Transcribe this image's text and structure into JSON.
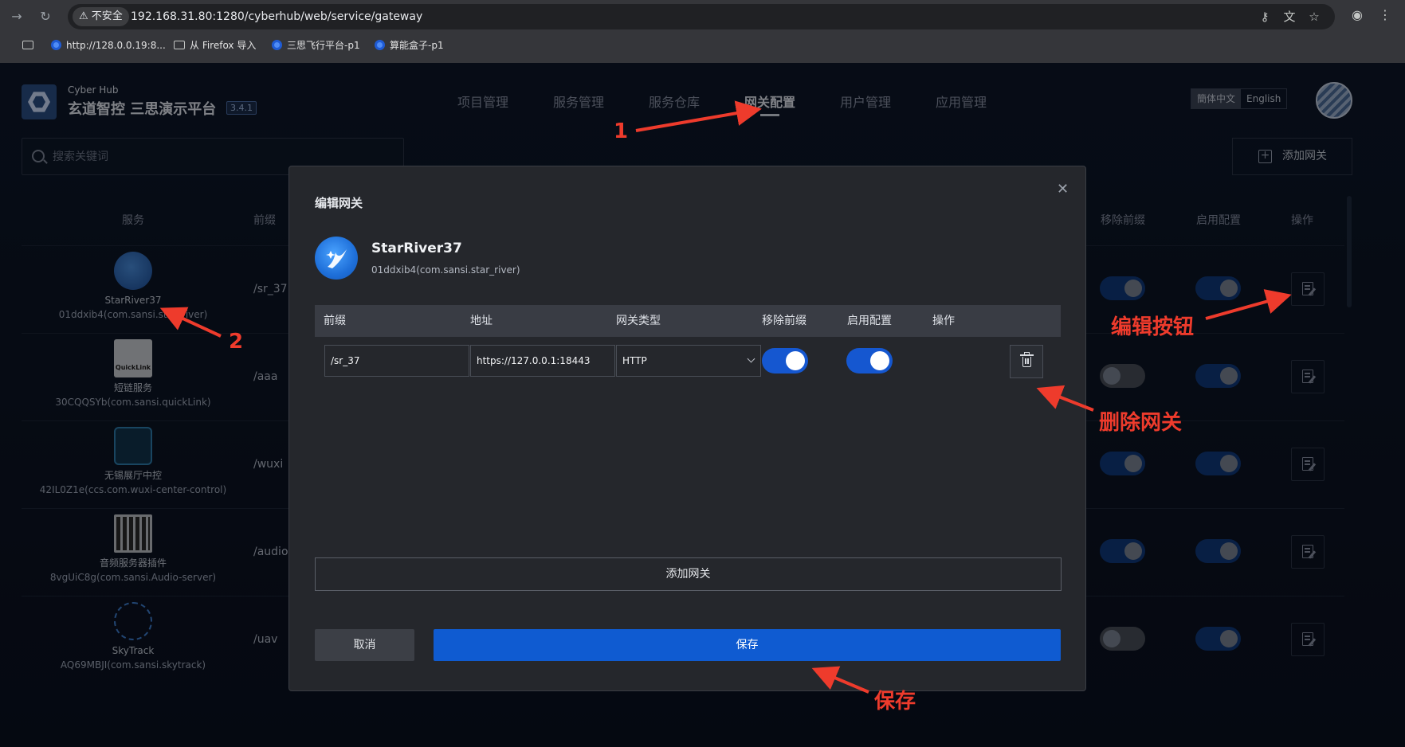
{
  "browser": {
    "insecure_label": "不安全",
    "url": "192.168.31.80:1280/cyberhub/web/service/gateway",
    "bookmarks": [
      "http://128.0.0.19:8...",
      "从 Firefox 导入",
      "三思飞行平台-p1",
      "算能盒子-p1"
    ]
  },
  "header": {
    "brand_sub": "Cyber Hub",
    "brand_title": "玄道智控 三思演示平台",
    "version": "3.4.1",
    "nav": [
      "项目管理",
      "服务管理",
      "服务仓库",
      "网关配置",
      "用户管理",
      "应用管理"
    ],
    "active_nav": "网关配置",
    "lang_options": [
      "簡体中文",
      "English"
    ]
  },
  "toolbar": {
    "search_placeholder": "搜索关键词",
    "add_gateway_label": "添加网关"
  },
  "table": {
    "headers": [
      "服务",
      "前缀",
      "移除前缀",
      "启用配置",
      "操作"
    ],
    "rows": [
      {
        "name": "StarRiver37",
        "id": "01ddxib4(com.sansi.star_river)",
        "prefix": "/sr_37",
        "remove_prefix": true,
        "enabled": true,
        "icon": "star-river-icon"
      },
      {
        "name": "短链服务",
        "id": "30CQQSYb(com.sansi.quickLink)",
        "prefix": "/aaa",
        "remove_prefix": false,
        "enabled": true,
        "icon": "quicklink-icon",
        "icon_text": "QuickLink"
      },
      {
        "name": "无锡展厅中控",
        "id": "42IL0Z1e(ccs.com.wuxi-center-control)",
        "prefix": "/wuxi",
        "remove_prefix": true,
        "enabled": true,
        "icon": "cube-icon"
      },
      {
        "name": "音频服务器插件",
        "id": "8vgUiC8g(com.sansi.Audio-server)",
        "prefix": "/audio",
        "remove_prefix": true,
        "enabled": true,
        "icon": "audio-mixer-icon"
      },
      {
        "name": "SkyTrack",
        "id": "AQ69MBJI(com.sansi.skytrack)",
        "prefix": "/uav",
        "remove_prefix": false,
        "enabled": true,
        "icon": "network-nodes-icon"
      }
    ]
  },
  "modal": {
    "title": "编辑网关",
    "service_name": "StarRiver37",
    "service_id": "01ddxib4(com.sansi.star_river)",
    "columns": [
      "前缀",
      "地址",
      "网关类型",
      "移除前缀",
      "启用配置",
      "操作"
    ],
    "row": {
      "prefix": "/sr_37",
      "address": "https://127.0.0.1:18443",
      "type": "HTTP",
      "remove_prefix": true,
      "enabled": true
    },
    "add_label": "添加网关",
    "cancel_label": "取消",
    "save_label": "保存"
  },
  "annotations": {
    "step1": "1",
    "step2": "2",
    "edit_button": "编辑按钮",
    "delete_gateway": "删除网关",
    "save": "保存"
  },
  "colors": {
    "accent": "#0f5bd1",
    "annotation": "#ee3b2c",
    "toggle_on": "#1557d0"
  }
}
